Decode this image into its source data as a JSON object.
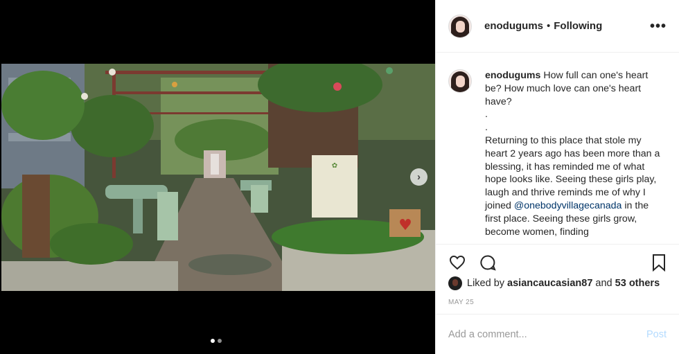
{
  "post": {
    "username": "enodugums",
    "separator": "•",
    "follow_status": "Following",
    "more_icon": "more-options-icon"
  },
  "caption": {
    "username": "enodugums",
    "text_1": "How full can one's heart be? How much love can one's heart have?",
    "dot_1": ".",
    "dot_2": ".",
    "text_2": "Returning to this place that stole my heart 2 years ago has been more than a blessing, it has reminded me of what hope looks like. Seeing these girls play, laugh and thrive reminds me of why I joined",
    "mention": "@onebodyvillagecanada",
    "text_3": "in the first place. Seeing these girls grow, become women, finding"
  },
  "carousel": {
    "next_label": "›",
    "current_slide": 1,
    "total_slides": 2
  },
  "likes": {
    "prefix": "Liked by",
    "user": "asiancaucasian87",
    "middle": "and",
    "others": "53 others"
  },
  "date": "MAY 25",
  "comment": {
    "placeholder": "Add a comment...",
    "post_label": "Post"
  },
  "colors": {
    "mention": "#003569",
    "post_disabled": "#b3dbff",
    "muted": "#999999"
  }
}
